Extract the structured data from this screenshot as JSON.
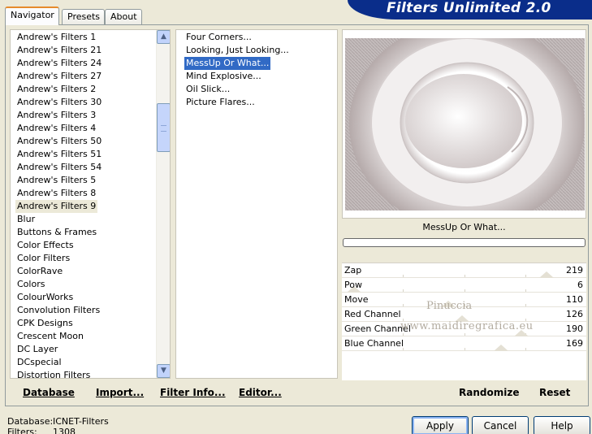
{
  "banner": {
    "title": "Filters Unlimited 2.0"
  },
  "tabs": [
    {
      "label": "Navigator",
      "active": true
    },
    {
      "label": "Presets",
      "active": false
    },
    {
      "label": "About",
      "active": false
    }
  ],
  "categories": {
    "selected": "Andrew's Filters 9",
    "items": [
      "Andrew's Filters 1",
      "Andrew's Filters 21",
      "Andrew's Filters 24",
      "Andrew's Filters 27",
      "Andrew's Filters 2",
      "Andrew's Filters 30",
      "Andrew's Filters 3",
      "Andrew's Filters 4",
      "Andrew's Filters 50",
      "Andrew's Filters 51",
      "Andrew's Filters 54",
      "Andrew's Filters 5",
      "Andrew's Filters 8",
      "Andrew's Filters 9",
      "Blur",
      "Buttons & Frames",
      "Color Effects",
      "Color Filters",
      "ColorRave",
      "Colors",
      "ColourWorks",
      "Convolution Filters",
      "CPK Designs",
      "Crescent Moon",
      "DC Layer",
      "DCspecial",
      "Distortion Filters"
    ]
  },
  "filters": {
    "selected": "MessUp Or What...",
    "items": [
      "Four Corners...",
      "Looking, Just Looking...",
      "MessUp Or What...",
      "Mind Explosive...",
      "Oil Slick...",
      "Picture Flares..."
    ]
  },
  "preview": {
    "filter_name": "MessUp Or What..."
  },
  "parameters": [
    {
      "name": "Zap",
      "value": 219,
      "level": 0.86
    },
    {
      "name": "Pow",
      "value": 6,
      "level": 0.02
    },
    {
      "name": "Move",
      "value": 110,
      "level": 0.43
    },
    {
      "name": "Red Channel",
      "value": 126,
      "level": 0.49
    },
    {
      "name": "Green Channel",
      "value": 190,
      "level": 0.75
    },
    {
      "name": "Blue Channel",
      "value": 169,
      "level": 0.66
    }
  ],
  "watermark": {
    "line1": "Pinuccia",
    "line2": "www.maidiregrafica.eu"
  },
  "links": {
    "database": "Database",
    "import": "Import...",
    "filter_info": "Filter Info...",
    "editor": "Editor...",
    "randomize": "Randomize",
    "reset": "Reset"
  },
  "status": {
    "database_label": "Database:",
    "database_value": "ICNET-Filters",
    "filters_label": "Filters:",
    "filters_value": "1308"
  },
  "buttons": {
    "apply": "Apply",
    "cancel": "Cancel",
    "help": "Help"
  },
  "colors": {
    "banner": "#0a2d8a",
    "selection": "#316ac5",
    "face": "#ece9d8"
  }
}
